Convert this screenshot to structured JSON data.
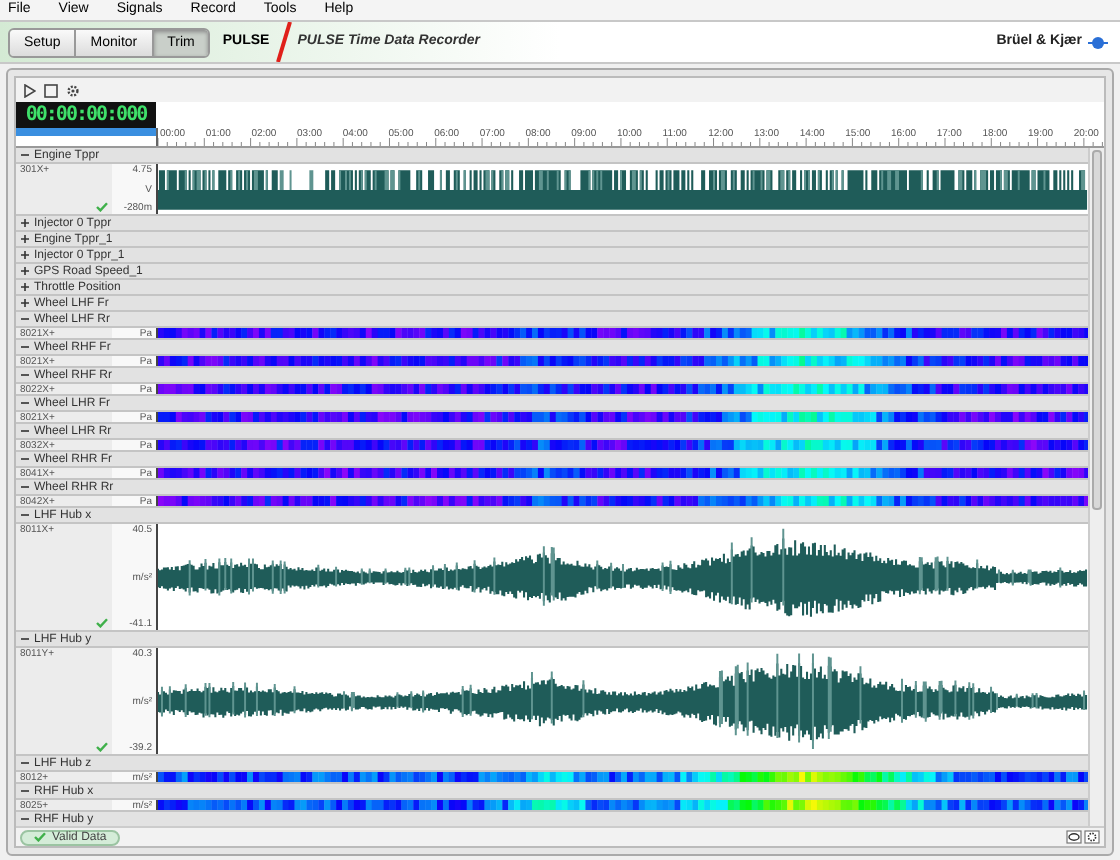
{
  "menu": [
    "File",
    "View",
    "Signals",
    "Record",
    "Tools",
    "Help"
  ],
  "tabs": [
    {
      "label": "Setup",
      "selected": false
    },
    {
      "label": "Monitor",
      "selected": false
    },
    {
      "label": "Trim",
      "selected": true
    }
  ],
  "app": {
    "name": "PULSE",
    "product": "PULSE Time Data Recorder",
    "brand": "Brüel & Kjær"
  },
  "time_display": "00:00:00:000",
  "ruler": [
    "00:00",
    "01:00",
    "02:00",
    "03:00",
    "04:00",
    "05:00",
    "06:00",
    "07:00",
    "08:00",
    "09:00",
    "10:00",
    "11:00",
    "12:00",
    "13:00",
    "14:00",
    "15:00",
    "16:00",
    "17:00",
    "18:00",
    "19:00",
    "20:00"
  ],
  "channels": [
    {
      "name": "Engine Tppr",
      "expanded": true,
      "kind": "pulse",
      "id": "301X+",
      "max": "4.75",
      "unit": "V",
      "min": "-280m",
      "valid": true
    },
    {
      "name": "Injector 0 Tppr",
      "expanded": false
    },
    {
      "name": "Engine Tppr_1",
      "expanded": false
    },
    {
      "name": "Injector 0 Tppr_1",
      "expanded": false
    },
    {
      "name": "GPS Road Speed_1",
      "expanded": false
    },
    {
      "name": "Throttle Position",
      "expanded": false
    },
    {
      "name": "Wheel LHF Fr",
      "expanded": false
    },
    {
      "name": "Wheel LHF Rr",
      "expanded": true,
      "kind": "heatmap",
      "id": "8021X+",
      "unit": "Pa"
    },
    {
      "name": "Wheel RHF Fr",
      "expanded": true,
      "kind": "heatmap",
      "id": "8021X+",
      "unit": "Pa"
    },
    {
      "name": "Wheel RHF Rr",
      "expanded": true,
      "kind": "heatmap",
      "id": "8022X+",
      "unit": "Pa"
    },
    {
      "name": "Wheel LHR Fr",
      "expanded": true,
      "kind": "heatmap",
      "id": "8021X+",
      "unit": "Pa"
    },
    {
      "name": "Wheel LHR Rr",
      "expanded": true,
      "kind": "heatmap",
      "id": "8032X+",
      "unit": "Pa"
    },
    {
      "name": "Wheel RHR Fr",
      "expanded": true,
      "kind": "heatmap",
      "id": "8041X+",
      "unit": "Pa"
    },
    {
      "name": "Wheel RHR Rr",
      "expanded": true,
      "kind": "heatmap",
      "id": "8042X+",
      "unit": "Pa"
    },
    {
      "name": "LHF Hub x",
      "expanded": true,
      "kind": "waveform",
      "id": "8011X+",
      "max": "40.5",
      "unit": "m/s²",
      "min": "-41.1",
      "valid": true
    },
    {
      "name": "LHF Hub y",
      "expanded": true,
      "kind": "waveform",
      "id": "8011Y+",
      "max": "40.3",
      "unit": "m/s²",
      "min": "-39.2",
      "valid": true
    },
    {
      "name": "LHF Hub z",
      "expanded": true,
      "kind": "heatmap",
      "id": "8012+",
      "unit": "m/s²"
    },
    {
      "name": "RHF Hub x",
      "expanded": true,
      "kind": "heatmap",
      "id": "8025+",
      "unit": "m/s²"
    },
    {
      "name": "RHF Hub y",
      "expanded": true
    }
  ],
  "footer": {
    "button": "Valid Data"
  }
}
